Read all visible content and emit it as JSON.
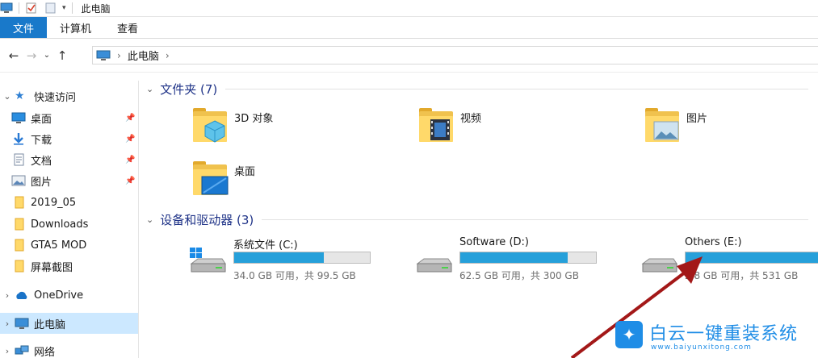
{
  "window": {
    "title": "此电脑"
  },
  "ribbon": {
    "tabs": [
      "文件",
      "计算机",
      "查看"
    ]
  },
  "address": {
    "crumbs": [
      "此电脑"
    ]
  },
  "nav": {
    "quick_access": "快速访问",
    "items": [
      {
        "label": "桌面",
        "icon": "desktop-icon",
        "pinned": true
      },
      {
        "label": "下载",
        "icon": "download-icon",
        "pinned": true
      },
      {
        "label": "文档",
        "icon": "document-icon",
        "pinned": true
      },
      {
        "label": "图片",
        "icon": "pictures-icon",
        "pinned": true
      },
      {
        "label": "2019_05",
        "icon": "folder-icon",
        "pinned": false
      },
      {
        "label": "Downloads",
        "icon": "folder-icon",
        "pinned": false
      },
      {
        "label": "GTA5 MOD",
        "icon": "folder-icon",
        "pinned": false
      },
      {
        "label": "屏幕截图",
        "icon": "folder-icon",
        "pinned": false
      }
    ],
    "onedrive": "OneDrive",
    "this_pc": "此电脑",
    "network": "网络"
  },
  "folders": {
    "heading": "文件夹 (7)",
    "items": [
      {
        "label": "3D 对象",
        "icon": "3d-objects-icon"
      },
      {
        "label": "视频",
        "icon": "videos-icon"
      },
      {
        "label": "图片",
        "icon": "pictures-folder-icon"
      },
      {
        "label": "桌面",
        "icon": "desktop-folder-icon"
      }
    ]
  },
  "drives": {
    "heading": "设备和驱动器 (3)",
    "items": [
      {
        "name": "系统文件 (C:)",
        "info": "34.0 GB 可用，共 99.5 GB",
        "used_fraction": 0.66,
        "icon": "windows-drive-icon"
      },
      {
        "name": "Software (D:)",
        "info": "62.5 GB 可用，共 300 GB",
        "used_fraction": 0.79,
        "icon": "drive-icon"
      },
      {
        "name": "Others (E:)",
        "info": "2.8 GB 可用，共 531 GB",
        "used_fraction": 0.99,
        "icon": "drive-icon"
      }
    ]
  },
  "watermark": {
    "brand": "白云一键重装系统",
    "url": "www.baiyunxitong.com"
  },
  "colors": {
    "accent": "#1979ca",
    "bar_fill": "#26a0da",
    "arrow": "#a31818"
  }
}
